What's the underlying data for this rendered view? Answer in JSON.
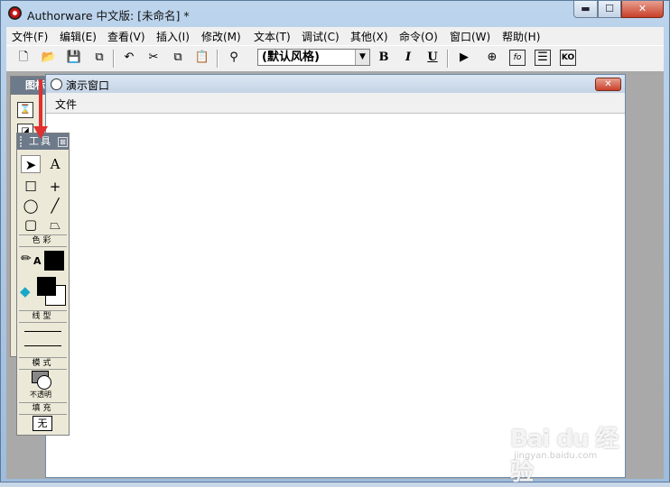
{
  "window": {
    "title": "Authorware 中文版: [未命名] *",
    "min_glyph": "▬",
    "max_glyph": "☐",
    "close_glyph": "✕"
  },
  "menu": [
    "文件(F)",
    "编辑(E)",
    "查看(V)",
    "插入(I)",
    "修改(M)",
    "文本(T)",
    "调试(C)",
    "其他(X)",
    "命令(O)",
    "窗口(W)",
    "帮助(H)"
  ],
  "toolbar": {
    "new": "🗋",
    "open": "📂",
    "save": "💾",
    "import": "⧉",
    "undo": "↶",
    "cut": "✂",
    "copy": "⧉",
    "paste": "📋",
    "find": "⚲",
    "style_value": "(默认风格)",
    "combo_arrow": "▼",
    "bold": "B",
    "italic": "I",
    "underline": "U",
    "run": "▶",
    "control": "⊕",
    "functions": "fo",
    "variables": "☰",
    "ko": "KO"
  },
  "icon_palette": {
    "title": "图标"
  },
  "presentation": {
    "title": "演示窗口",
    "menu_file": "文件",
    "close": "✕"
  },
  "tools": {
    "title": "工具",
    "close": "⊠",
    "pointer": "➤",
    "text": "A",
    "rect": "☐",
    "cross": "+",
    "oval": "◯",
    "line": "╱",
    "rrect": "▢",
    "polygon": "⏢",
    "color_head": "色彩",
    "line_head": "线型",
    "mode_head": "模式",
    "mode_value": "不透明",
    "fill_head": "填充",
    "fill_value": "无"
  },
  "watermark": {
    "main": "Bai du 经验",
    "sub": "jingyan.baidu.com"
  },
  "colors": {
    "accent_red": "#e03030",
    "title_bar": "#6d7a8a"
  }
}
